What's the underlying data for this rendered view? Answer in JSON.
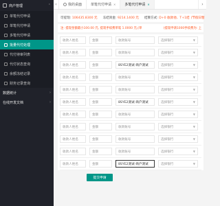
{
  "sidebar": {
    "group1": "商户管理",
    "items": [
      {
        "label": "单笔代付申请",
        "active": false
      },
      {
        "label": "单笔代付申请",
        "active": false
      },
      {
        "label": "多笔代付申请",
        "active": false
      },
      {
        "label": "批量代付处理",
        "active": true
      },
      {
        "label": "代付待审列表",
        "active": false
      },
      {
        "label": "代付状态查询",
        "active": false
      },
      {
        "label": "余额冻结记录",
        "active": false
      },
      {
        "label": "财务记录查询",
        "active": false
      }
    ],
    "group2": "数据统计",
    "group3": "在线开发文档"
  },
  "tabs": [
    {
      "label": "我的桌面",
      "active": false
    },
    {
      "label": "单笔代付申请",
      "active": false
    },
    {
      "label": "多笔代付申请",
      "active": true
    }
  ],
  "balance": {
    "available_label": "可提现:",
    "available_value": "106435.8300 元",
    "frozen_label": "冻结资金:",
    "frozen_value": "9214.1400 元",
    "fee_label": "结算方式:",
    "fee_value": "D+0 收款他、T+1结",
    "note": "(节假日暂"
  },
  "notice": {
    "left": "注: 提现金额最小100.00 元, 提现手续费单笔 1.0000 元,(单",
    "right": "(提现申请1000手续费为: 上"
  },
  "form": {
    "name_placeholder": "收款人姓名",
    "amount_placeholder": "金额",
    "account_placeholder": "收款账号",
    "bank_placeholder": "选择银行",
    "filled_account": "8SYE2测试-商户测试",
    "rows": [
      {
        "account_filled": false,
        "focus": false
      },
      {
        "account_filled": false,
        "focus": false
      },
      {
        "account_filled": true,
        "focus": false
      },
      {
        "account_filled": false,
        "focus": false
      },
      {
        "account_filled": false,
        "focus": false
      },
      {
        "account_filled": true,
        "focus": false
      },
      {
        "account_filled": false,
        "focus": false
      },
      {
        "account_filled": false,
        "focus": false
      },
      {
        "account_filled": false,
        "focus": false
      },
      {
        "account_filled": false,
        "focus": false
      },
      {
        "account_filled": true,
        "focus": true
      }
    ]
  },
  "submit_label": "提交申请",
  "accent_color": "#009688",
  "warning_color": "#ff5722"
}
